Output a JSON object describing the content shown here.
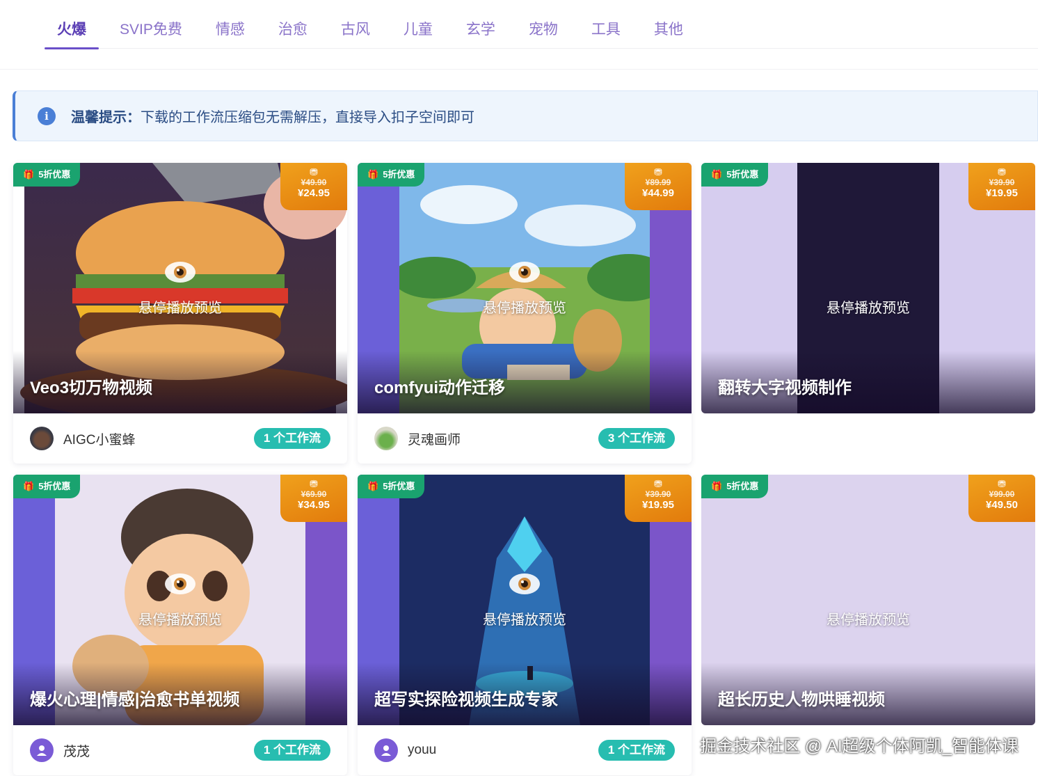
{
  "tabs": [
    {
      "label": "火爆",
      "active": true
    },
    {
      "label": "SVIP免费"
    },
    {
      "label": "情感"
    },
    {
      "label": "治愈"
    },
    {
      "label": "古风"
    },
    {
      "label": "儿童"
    },
    {
      "label": "玄学"
    },
    {
      "label": "宠物"
    },
    {
      "label": "工具"
    },
    {
      "label": "其他"
    }
  ],
  "notice": {
    "icon": "info-icon",
    "strong": "温馨提示：",
    "text": "下载的工作流压缩包无需解压，直接导入扣子空间即可"
  },
  "cards": [
    {
      "title": "Veo3切万物视频",
      "discount": "5折优惠",
      "old_price": "¥49.90",
      "new_price": "¥24.95",
      "hover": "悬停播放预览",
      "author": "AIGC小蜜蜂",
      "workflows": "1 个工作流",
      "art": "burger"
    },
    {
      "title": "comfyui动作迁移",
      "discount": "5折优惠",
      "old_price": "¥89.99",
      "new_price": "¥44.99",
      "hover": "悬停播放预览",
      "author": "灵魂画师",
      "workflows": "3 个工作流",
      "art": "meadow"
    },
    {
      "title": "翻转大字视频制作",
      "discount": "5折优惠",
      "old_price": "¥39.90",
      "new_price": "¥19.95",
      "hover": "悬停播放预览",
      "author": "",
      "workflows": "",
      "art": "dark"
    },
    {
      "title": "爆火心理|情感|治愈书单视频",
      "discount": "5折优惠",
      "old_price": "¥69.90",
      "new_price": "¥34.95",
      "hover": "悬停播放预览",
      "author": "茂茂",
      "workflows": "1 个工作流",
      "art": "boy"
    },
    {
      "title": "超写实探险视频生成专家",
      "discount": "5折优惠",
      "old_price": "¥39.90",
      "new_price": "¥19.95",
      "hover": "悬停播放预览",
      "author": "youu",
      "workflows": "1 个工作流",
      "art": "cave"
    },
    {
      "title": "超长历史人物哄睡视频",
      "discount": "5折优惠",
      "old_price": "¥99.00",
      "new_price": "¥49.50",
      "hover": "悬停播放预览",
      "author": "",
      "workflows": "",
      "art": "blank"
    }
  ],
  "watermark": "掘金技术社区 @ AI超级个体阿凯_智能体课",
  "colors": {
    "accent": "#6a4fc9",
    "discount_badge": "#1aa36f",
    "price_badge": "#e88f14",
    "workflow_badge": "#27bdb0",
    "notice_border": "#4a7fd6"
  }
}
